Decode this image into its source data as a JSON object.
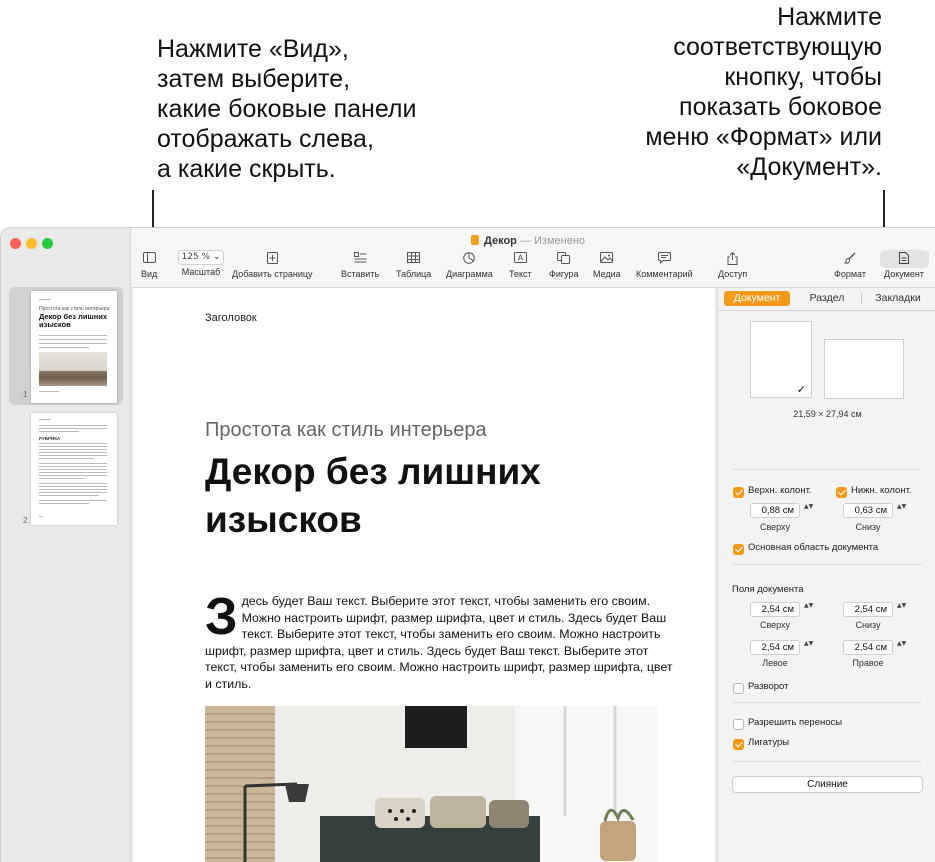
{
  "callouts": {
    "left": [
      "Нажмите «Вид»,",
      "затем выберите,",
      "какие боковые панели",
      "отображать слева,",
      "а какие скрыть."
    ],
    "right": [
      "Нажмите",
      "соответствующую",
      "кнопку, чтобы",
      "показать боковое",
      "меню «Формат» или",
      "«Документ»."
    ]
  },
  "window": {
    "doc_name": "Декор",
    "doc_sep": "—",
    "doc_status": "Изменено"
  },
  "toolbar": {
    "view": {
      "label": "Вид",
      "icon": "sidebar-icon"
    },
    "zoom": {
      "label": "Масштаб",
      "value": "125 %",
      "icon": "chevron-down-icon"
    },
    "add_page": {
      "label": "Добавить страницу",
      "icon": "add-page-icon"
    },
    "insert": {
      "label": "Вставить",
      "icon": "insert-icon"
    },
    "table": {
      "label": "Таблица",
      "icon": "table-icon"
    },
    "chart": {
      "label": "Диаграмма",
      "icon": "chart-icon"
    },
    "text": {
      "label": "Текст",
      "icon": "text-box-icon"
    },
    "shape": {
      "label": "Фигура",
      "icon": "shape-icon"
    },
    "media": {
      "label": "Медиа",
      "icon": "media-icon"
    },
    "comment": {
      "label": "Комментарий",
      "icon": "comment-icon"
    },
    "share": {
      "label": "Доступ",
      "icon": "share-icon"
    },
    "format": {
      "label": "Формат",
      "icon": "paintbrush-icon"
    },
    "document": {
      "label": "Документ",
      "icon": "document-icon"
    }
  },
  "thumbnails": [
    {
      "number": "1",
      "selected": true,
      "subtitle": "Простота как стиль интерьера",
      "title": "Декор без лишних изысков"
    },
    {
      "number": "2",
      "selected": false,
      "heading": "РУБРИКА"
    }
  ],
  "page": {
    "header": "Заголовок",
    "subtitle": "Простота как стиль интерьера",
    "title": "Декор без лишних изысков",
    "dropcap": "З",
    "body": "десь будет Ваш текст. Выберите этот текст, чтобы заменить его своим. Можно настроить шрифт, размер шрифта, цвет и стиль. Здесь будет Ваш текст. Выберите этот текст, чтобы заменить его своим. Можно настроить шрифт, размер шрифта, цвет и стиль. Здесь будет Ваш текст. Выберите этот текст, чтобы заменить его своим. Можно настроить шрифт, размер шрифта, цвет и стиль."
  },
  "inspector": {
    "tabs": [
      {
        "label": "Документ",
        "active": true
      },
      {
        "label": "Раздел",
        "active": false
      },
      {
        "label": "Закладки",
        "active": false
      }
    ],
    "paper_size": "21,59 × 27,94 см",
    "header_footer": {
      "header_label": "Верхн. колонт.",
      "header_checked": true,
      "footer_label": "Нижн. колонт.",
      "footer_checked": true,
      "top_value": "0,88 см",
      "top_caption": "Сверху",
      "bottom_value": "0,63 см",
      "bottom_caption": "Снизу"
    },
    "body_area": {
      "label": "Основная область документа",
      "checked": true
    },
    "margins": {
      "title": "Поля документа",
      "top": {
        "value": "2,54 см",
        "caption": "Сверху"
      },
      "bottom": {
        "value": "2,54 см",
        "caption": "Снизу"
      },
      "left": {
        "value": "2,54 см",
        "caption": "Левое"
      },
      "right": {
        "value": "2,54 см",
        "caption": "Правое"
      }
    },
    "facing": {
      "label": "Разворот",
      "checked": false
    },
    "hyphenation": {
      "label": "Разрешить переносы",
      "checked": false
    },
    "ligatures": {
      "label": "Лигатуры",
      "checked": true
    },
    "merge_button": "Слияние",
    "stepper_arrows": "▲▼",
    "checkmark": "✓"
  },
  "colors": {
    "accent": "#f39a1b",
    "traffic_close": "#fe5f57",
    "traffic_min": "#febc2e",
    "traffic_max": "#28c840"
  }
}
